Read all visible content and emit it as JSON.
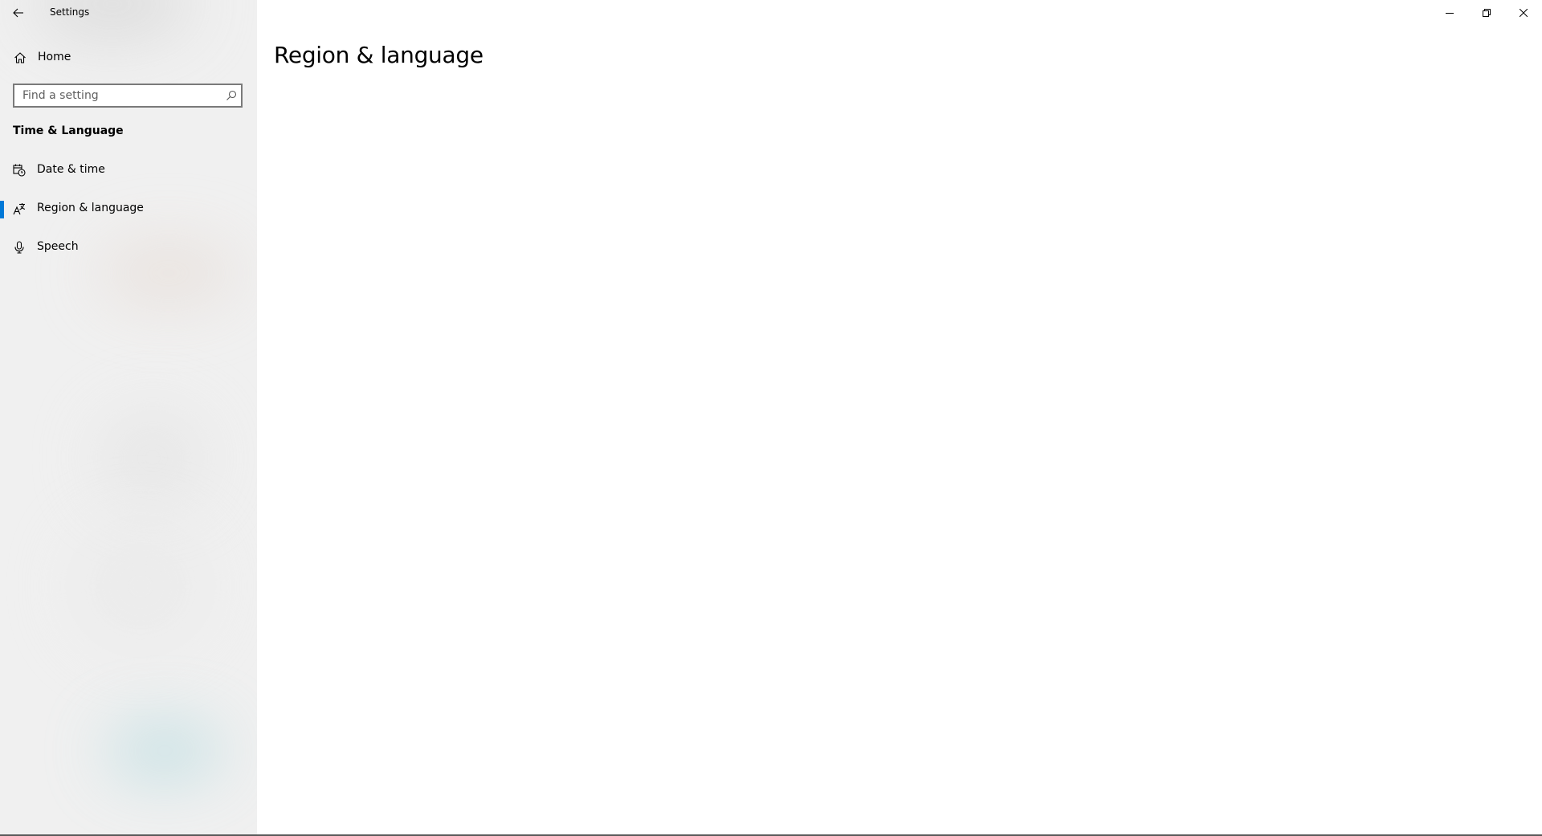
{
  "window": {
    "title": "Settings",
    "controls": {
      "minimize_icon": "minimize-icon",
      "restore_icon": "restore-icon",
      "close_icon": "close-icon"
    }
  },
  "sidebar": {
    "home_label": "Home",
    "search": {
      "placeholder": "Find a setting",
      "value": ""
    },
    "section_title": "Time & Language",
    "items": [
      {
        "label": "Date & time",
        "icon": "calendar-clock-icon",
        "selected": false
      },
      {
        "label": "Region & language",
        "icon": "language-icon",
        "selected": true
      },
      {
        "label": "Speech",
        "icon": "microphone-icon",
        "selected": false
      }
    ]
  },
  "main": {
    "title": "Region & language"
  },
  "colors": {
    "accent": "#0078d7",
    "sidebar_bg": "#f0f0f0",
    "content_bg": "#ffffff"
  }
}
